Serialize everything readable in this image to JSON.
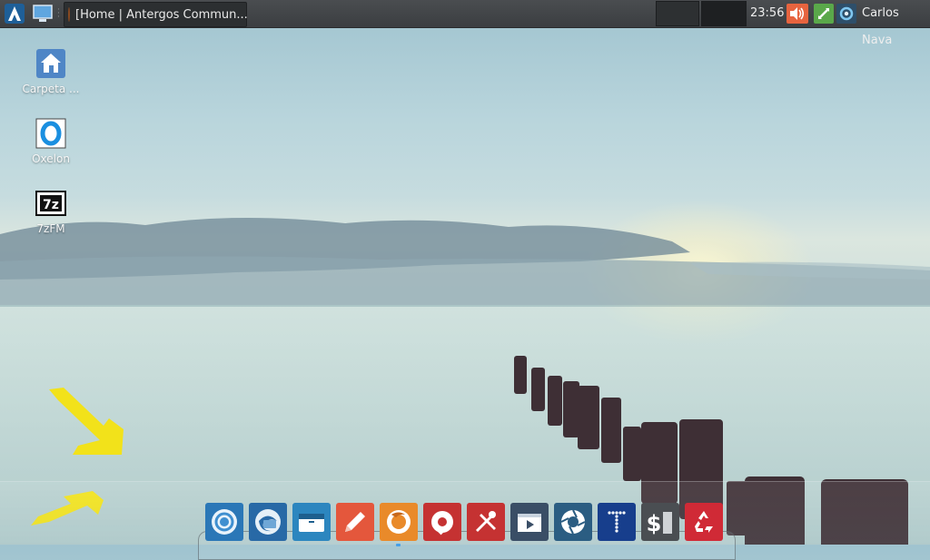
{
  "top_panel": {
    "task_title": "[Home | Antergos Commun...",
    "clock": "23:56",
    "user": "Carlos Nava"
  },
  "desktop_icons": [
    {
      "label": "Carpeta ...",
      "icon": "home-folder-icon"
    },
    {
      "label": "Oxelon",
      "icon": "oxelon-icon"
    },
    {
      "label": "7zFM",
      "icon": "7zip-icon"
    }
  ],
  "dock": [
    {
      "app": "chromium",
      "icon": "chromium-icon",
      "color": "#2a77b7"
    },
    {
      "app": "thunderbird",
      "icon": "thunderbird-icon",
      "color": "#2869a6"
    },
    {
      "app": "file-manager",
      "icon": "file-manager-icon",
      "color": "#2c86bf"
    },
    {
      "app": "text-editor",
      "icon": "pencil-icon",
      "color": "#e4573c"
    },
    {
      "app": "firefox",
      "icon": "firefox-icon",
      "color": "#e98a2a"
    },
    {
      "app": "tweak-tool",
      "icon": "tweak-icon",
      "color": "#c53232"
    },
    {
      "app": "system-tools",
      "icon": "tools-icon",
      "color": "#c53232"
    },
    {
      "app": "video-player",
      "icon": "video-icon",
      "color": "#3a4e66"
    },
    {
      "app": "shutter",
      "icon": "aperture-icon",
      "color": "#2b5d82"
    },
    {
      "app": "typecatcher",
      "icon": "type-icon",
      "color": "#173e8c"
    },
    {
      "app": "terminal",
      "icon": "terminal-icon",
      "color": "#4a4e52"
    },
    {
      "app": "trash",
      "icon": "recycle-icon",
      "color": "#d02a36"
    }
  ]
}
